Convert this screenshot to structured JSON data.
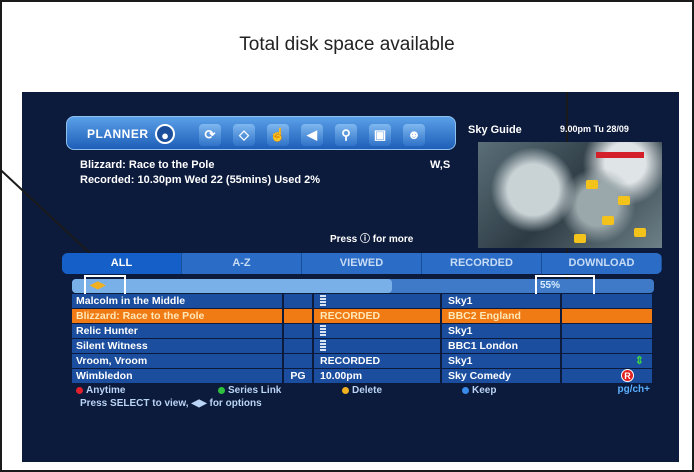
{
  "callout": {
    "title": "Total disk space available"
  },
  "planner": {
    "label": "PLANNER",
    "icons": [
      "record-icon",
      "reminder-icon",
      "tag-icon",
      "hand-icon",
      "back-icon",
      "search-icon",
      "lock-icon",
      "person-icon"
    ],
    "selected_title": "Blizzard: Race to the Pole",
    "recorded_info": "Recorded: 10.30pm Wed 22 (55mins) Used 2%",
    "codes": "W,S",
    "press_more": "Press ⓘ for more"
  },
  "guide": {
    "label": "Sky Guide",
    "time": "9.00pm Tu 28/09"
  },
  "tabs": [
    {
      "label": "ALL",
      "active": true
    },
    {
      "label": "A-Z",
      "active": false
    },
    {
      "label": "VIEWED",
      "active": false
    },
    {
      "label": "RECORDED",
      "active": false
    },
    {
      "label": "DOWNLOAD",
      "active": false
    }
  ],
  "disk": {
    "used_text": "55%",
    "used_fraction": 0.55
  },
  "rows": [
    {
      "title": "Malcolm in the Middle",
      "rating": "",
      "status": "",
      "channel": "Sky1",
      "selected": false,
      "stack": true
    },
    {
      "title": "Blizzard: Race to the Pole",
      "rating": "",
      "status": "RECORDED",
      "channel": "BBC2 England",
      "selected": true,
      "stack": false
    },
    {
      "title": "Relic Hunter",
      "rating": "",
      "status": "",
      "channel": "Sky1",
      "selected": false,
      "stack": true
    },
    {
      "title": "Silent Witness",
      "rating": "",
      "status": "",
      "channel": "BBC1 London",
      "selected": false,
      "stack": true
    },
    {
      "title": "Vroom, Vroom",
      "rating": "",
      "status": "RECORDED",
      "channel": "Sky1",
      "selected": false,
      "stack": false
    },
    {
      "title": "Wimbledon",
      "rating": "PG",
      "status": "10.00pm",
      "channel": "Sky Comedy",
      "selected": false,
      "stack": false
    }
  ],
  "footer": {
    "anytime": "Anytime",
    "series_link": "Series Link",
    "delete": "Delete",
    "keep": "Keep",
    "pgch": "pg/ch+",
    "help": "Press SELECT to view, ◀▶ for options",
    "colors": {
      "red": "#e0202a",
      "green": "#30c040",
      "yellow": "#f0b020",
      "blue": "#3a8ae8"
    }
  }
}
